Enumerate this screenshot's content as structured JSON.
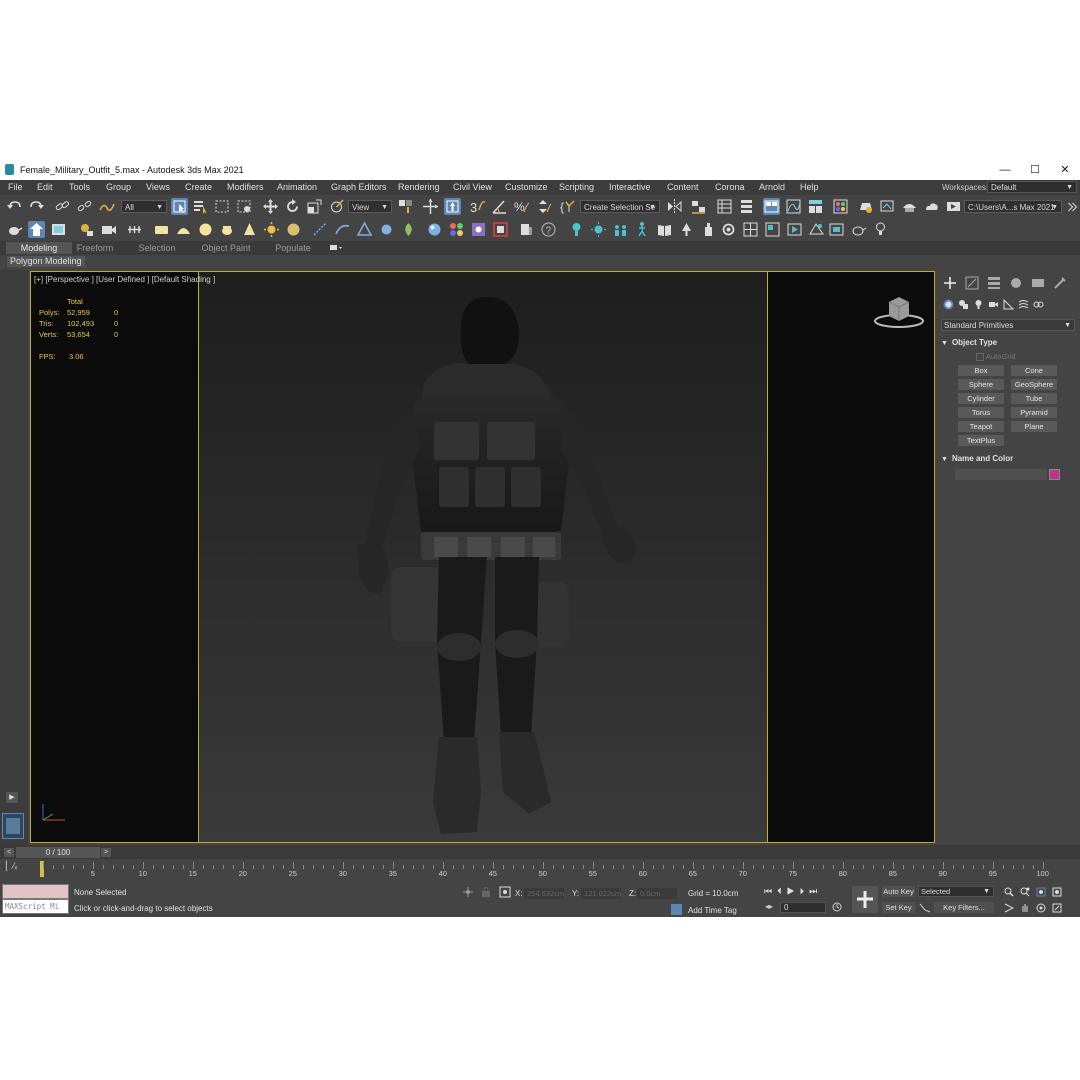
{
  "window": {
    "title": "Female_Military_Outfit_5.max - Autodesk 3ds Max 2021",
    "minimize": "—",
    "maximize": "☐",
    "close": "✕"
  },
  "menu": [
    "File",
    "Edit",
    "Tools",
    "Group",
    "Views",
    "Create",
    "Modifiers",
    "Animation",
    "Graph Editors",
    "Rendering",
    "Civil View",
    "Customize",
    "Scripting",
    "Interactive",
    "Content",
    "Corona",
    "Arnold",
    "Help"
  ],
  "workspaces": {
    "label": "Workspaces:",
    "value": "Default"
  },
  "toolbar": {
    "filter": "All",
    "ref_coord": "View",
    "selection_set": "Create Selection Se",
    "project_path": "C:\\Users\\A...s Max 2021"
  },
  "ribbon": {
    "tabs": [
      "Modeling",
      "Freeform",
      "Selection",
      "Object Paint",
      "Populate"
    ],
    "active": "Modeling",
    "panel": "Polygon Modeling"
  },
  "viewport": {
    "label": "[+] [Perspective ] [User Defined ] [Default Shading ]",
    "stats_header": "Total",
    "stats": [
      {
        "label": "Polys:",
        "total": "52,959",
        "sel": "0"
      },
      {
        "label": "Tris:",
        "total": "102,493",
        "sel": "0"
      },
      {
        "label": "Verts:",
        "total": "53,654",
        "sel": "0"
      }
    ],
    "fps_label": "FPS:",
    "fps": "3.06"
  },
  "command_panel": {
    "dropdown": "Standard Primitives",
    "object_type": {
      "title": "Object Type",
      "autogrid": "AutoGrid",
      "buttons": [
        "Box",
        "Cone",
        "Sphere",
        "GeoSphere",
        "Cylinder",
        "Tube",
        "Torus",
        "Pyramid",
        "Teapot",
        "Plane",
        "TextPlus"
      ]
    },
    "name_color": {
      "title": "Name and Color",
      "color": "#c0338a"
    }
  },
  "timeline": {
    "frame": "0 / 100",
    "prev": "<",
    "next": ">",
    "ticks": [
      "0",
      "5",
      "10",
      "15",
      "20",
      "25",
      "30",
      "35",
      "40",
      "45",
      "50",
      "55",
      "60",
      "65",
      "70",
      "75",
      "80",
      "85",
      "90",
      "95",
      "100"
    ]
  },
  "status": {
    "maxscript": "MAXScript Mi",
    "selection": "None Selected",
    "prompt": "Click or click-and-drag to select objects",
    "x_label": "X:",
    "x": "254.632cm",
    "y_label": "Y:",
    "y": "121.022cm",
    "z_label": "Z:",
    "z": "0.0cm",
    "grid": "Grid = 10.0cm",
    "add_time_tag": "Add Time Tag",
    "auto_key": "Auto Key",
    "set_key": "Set Key",
    "selected": "Selected",
    "key_filters": "Key Filters...",
    "frame_value": "0"
  }
}
